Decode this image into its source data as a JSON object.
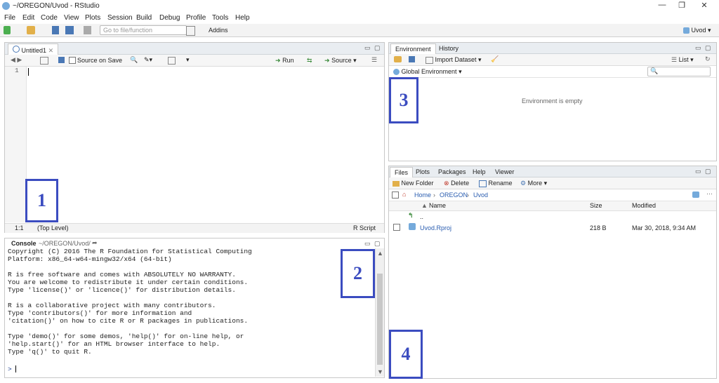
{
  "window": {
    "title": "~/OREGON/Uvod - RStudio",
    "minimize": "—",
    "restore": "❐",
    "close": "✕"
  },
  "menu": [
    "File",
    "Edit",
    "Code",
    "View",
    "Plots",
    "Session",
    "Build",
    "Debug",
    "Profile",
    "Tools",
    "Help"
  ],
  "toolbar": {
    "goto_placeholder": "Go to file/function",
    "addins": "Addins",
    "project": "Uvod"
  },
  "editor": {
    "tab": "Untitled1",
    "source_on_save": "Source on Save",
    "run": "Run",
    "source": "Source",
    "line_number": "1",
    "status_position": "1:1",
    "status_scope": "(Top Level)",
    "status_type": "R Script"
  },
  "console": {
    "title": "Console",
    "path": "~/OREGON/Uvod/",
    "lines": [
      "Copyright (C) 2016 The R Foundation for Statistical Computing",
      "Platform: x86_64-w64-mingw32/x64 (64-bit)",
      "",
      "R is free software and comes with ABSOLUTELY NO WARRANTY.",
      "You are welcome to redistribute it under certain conditions.",
      "Type 'license()' or 'licence()' for distribution details.",
      "",
      "R is a collaborative project with many contributors.",
      "Type 'contributors()' for more information and",
      "'citation()' on how to cite R or R packages in publications.",
      "",
      "Type 'demo()' for some demos, 'help()' for on-line help, or",
      "'help.start()' for an HTML browser interface to help.",
      "Type 'q()' to quit R."
    ],
    "prompt": ">"
  },
  "environment": {
    "tabs": [
      "Environment",
      "History"
    ],
    "import_dataset": "Import Dataset",
    "list": "List",
    "global_env": "Global Environment",
    "empty": "Environment is empty"
  },
  "files": {
    "tabs": [
      "Files",
      "Plots",
      "Packages",
      "Help",
      "Viewer"
    ],
    "new_folder": "New Folder",
    "delete": "Delete",
    "rename": "Rename",
    "more": "More",
    "breadcrumb": [
      "Home",
      "OREGON",
      "Uvod"
    ],
    "col_name": "Name",
    "col_size": "Size",
    "col_modified": "Modified",
    "rows": [
      {
        "name": "..",
        "size": "",
        "modified": ""
      },
      {
        "name": "Uvod.Rproj",
        "size": "218 B",
        "modified": "Mar 30, 2018, 9:34 AM"
      }
    ]
  },
  "labels": {
    "one": "1",
    "two": "2",
    "three": "3",
    "four": "4"
  },
  "colors": {
    "accent_box": "#3b4cc0",
    "pane_header": "#e9edf1"
  }
}
